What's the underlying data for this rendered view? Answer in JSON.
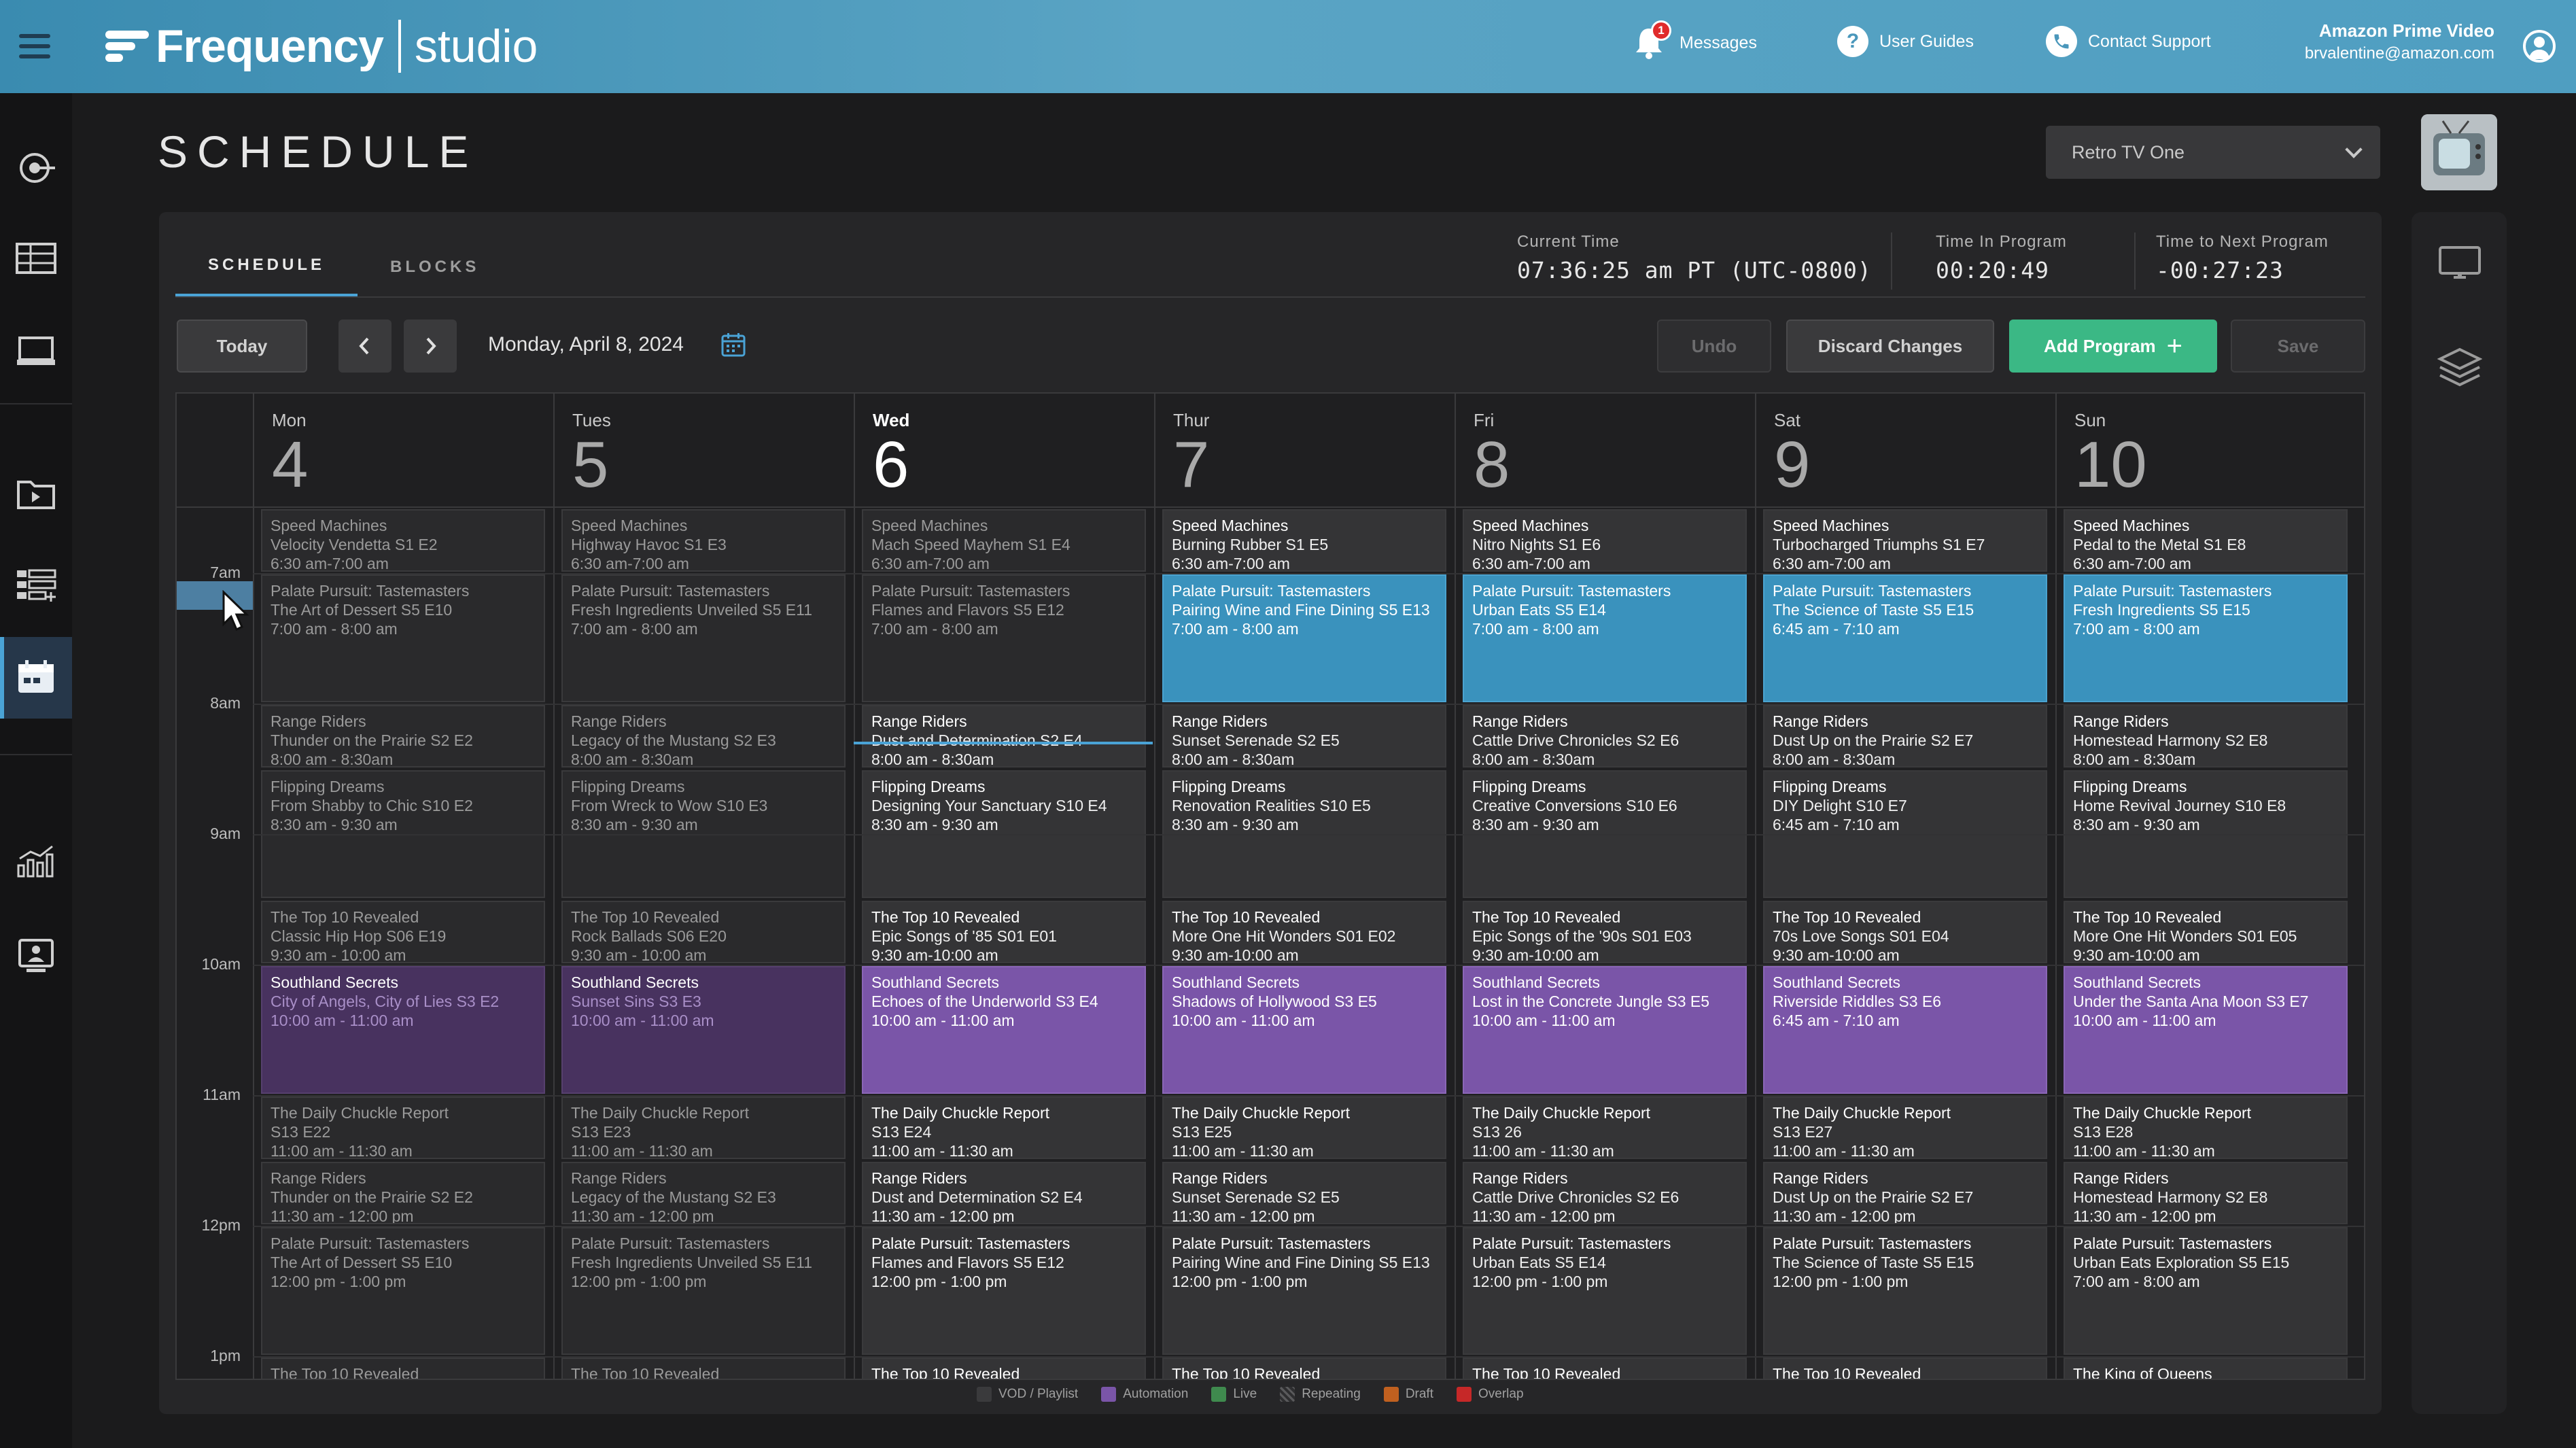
{
  "app": {
    "brand": "Frequency",
    "product": "studio",
    "messages_label": "Messages",
    "messages_badge": "1",
    "guides_label": "User Guides",
    "support_label": "Contact Support",
    "org_name": "Amazon Prime Video",
    "user_email": "brvalentine@amazon.com"
  },
  "page": {
    "title": "SCHEDULE",
    "channel": "Retro TV One"
  },
  "tabs": [
    "SCHEDULE",
    "BLOCKS"
  ],
  "stats": {
    "current_time_label": "Current Time",
    "current_time": "07:36:25 am PT (UTC-0800)",
    "time_in_program_label": "Time In Program",
    "time_in_program": "00:20:49",
    "time_to_next_label": "Time to Next Program",
    "time_to_next": "-00:27:23"
  },
  "toolbar": {
    "today": "Today",
    "date": "Monday, April 8, 2024",
    "undo": "Undo",
    "discard": "Discard Changes",
    "add_program": "Add Program",
    "save": "Save"
  },
  "days": [
    {
      "name": "Mon",
      "num": "4"
    },
    {
      "name": "Tues",
      "num": "5"
    },
    {
      "name": "Wed",
      "num": "6"
    },
    {
      "name": "Thur",
      "num": "7"
    },
    {
      "name": "Fri",
      "num": "8"
    },
    {
      "name": "Sat",
      "num": "9"
    },
    {
      "name": "Sun",
      "num": "10"
    }
  ],
  "times": [
    "7am",
    "8am",
    "9am",
    "10am",
    "11am",
    "12pm",
    "1pm"
  ],
  "events": [
    [
      {
        "l1": "Speed Machines",
        "l2": "Velocity Vendetta S1 E2",
        "l3": "6:30 am-7:00 am",
        "k": "dim"
      },
      {
        "l1": "Palate Pursuit: Tastemasters",
        "l2": "The Art of Dessert S5 E10",
        "l3": "7:00 am - 8:00 am",
        "k": "dim"
      },
      {
        "l1": "Range Riders",
        "l2": "Thunder on the Prairie S2 E2",
        "l3": "8:00 am - 8:30am",
        "k": "dim"
      },
      {
        "l1": "Flipping Dreams",
        "l2": "From Shabby to Chic S10 E2",
        "l3": "8:30 am - 9:30 am",
        "k": "dim"
      },
      {
        "l1": "The Top 10 Revealed",
        "l2": "Classic Hip Hop S06 E19",
        "l3": "9:30 am - 10:00 am",
        "k": "dim"
      },
      {
        "l1": "Southland Secrets",
        "l2": "City of Angels, City of Lies S3 E2",
        "l3": "10:00 am - 11:00 am",
        "k": "purple dim"
      },
      {
        "l1": "The Daily Chuckle Report",
        "l2": "S13 E22",
        "l3": "11:00 am - 11:30 am",
        "k": "dim"
      },
      {
        "l1": "Range Riders",
        "l2": "Thunder on the Prairie S2 E2",
        "l3": "11:30 am - 12:00 pm",
        "k": "dim"
      },
      {
        "l1": "Palate Pursuit: Tastemasters",
        "l2": "The Art of Dessert S5 E10",
        "l3": "12:00 pm - 1:00 pm",
        "k": "dim"
      },
      {
        "l1": "The Top 10 Revealed",
        "l2": "",
        "l3": "",
        "k": "dim"
      }
    ],
    [
      {
        "l1": "Speed Machines",
        "l2": "Highway Havoc S1 E3",
        "l3": "6:30 am-7:00 am",
        "k": "dim"
      },
      {
        "l1": "Palate Pursuit: Tastemasters",
        "l2": "Fresh Ingredients Unveiled S5 E11",
        "l3": "7:00 am - 8:00 am",
        "k": "dim"
      },
      {
        "l1": "Range Riders",
        "l2": "Legacy of the Mustang S2 E3",
        "l3": "8:00 am - 8:30am",
        "k": "dim"
      },
      {
        "l1": "Flipping Dreams",
        "l2": "From Wreck to Wow S10 E3",
        "l3": "8:30 am - 9:30 am",
        "k": "dim"
      },
      {
        "l1": "The Top 10 Revealed",
        "l2": "Rock Ballads S06 E20",
        "l3": "9:30 am - 10:00 am",
        "k": "dim"
      },
      {
        "l1": "Southland Secrets",
        "l2": "Sunset Sins S3 E3",
        "l3": "10:00 am - 11:00 am",
        "k": "purple dim"
      },
      {
        "l1": "The Daily Chuckle Report",
        "l2": "S13 E23",
        "l3": "11:00 am - 11:30 am",
        "k": "dim"
      },
      {
        "l1": "Range Riders",
        "l2": "Legacy of the Mustang S2 E3",
        "l3": "11:30 am - 12:00 pm",
        "k": "dim"
      },
      {
        "l1": "Palate Pursuit: Tastemasters",
        "l2": "Fresh Ingredients Unveiled S5 E11",
        "l3": "12:00 pm - 1:00 pm",
        "k": "dim"
      },
      {
        "l1": "The Top 10 Revealed",
        "l2": "",
        "l3": "",
        "k": "dim"
      }
    ],
    [
      {
        "l1": "Speed Machines",
        "l2": "Mach Speed Mayhem S1 E4",
        "l3": "6:30 am-7:00 am",
        "k": "dim"
      },
      {
        "l1": "Palate Pursuit: Tastemasters",
        "l2": "Flames and Flavors S5 E12",
        "l3": "7:00 am - 8:00 am",
        "k": "dim"
      },
      {
        "l1": "Range Riders",
        "l2": "Dust and Determination S2 E4",
        "l3": "8:00 am - 8:30am",
        "k": "cur"
      },
      {
        "l1": "Flipping Dreams",
        "l2": "Designing Your Sanctuary S10 E4",
        "l3": "8:30 am - 9:30 am",
        "k": "cur"
      },
      {
        "l1": "The Top 10 Revealed",
        "l2": "Epic Songs of '85 S01 E01",
        "l3": "9:30 am-10:00 am",
        "k": "cur"
      },
      {
        "l1": "Southland Secrets",
        "l2": "Echoes of the Underworld S3 E4",
        "l3": "10:00 am - 11:00 am",
        "k": "purple"
      },
      {
        "l1": "The Daily Chuckle Report",
        "l2": "S13 E24",
        "l3": "11:00 am - 11:30 am",
        "k": "cur"
      },
      {
        "l1": "Range Riders",
        "l2": "Dust and Determination S2 E4",
        "l3": "11:30 am - 12:00 pm",
        "k": "cur"
      },
      {
        "l1": "Palate Pursuit: Tastemasters",
        "l2": "Flames and Flavors S5 E12",
        "l3": "12:00 pm - 1:00 pm",
        "k": "cur"
      },
      {
        "l1": "The Top 10 Revealed",
        "l2": "",
        "l3": "",
        "k": "cur"
      }
    ],
    [
      {
        "l1": "Speed Machines",
        "l2": "Burning Rubber S1 E5",
        "l3": "6:30 am-7:00 am",
        "k": "cur"
      },
      {
        "l1": "Palate Pursuit: Tastemasters",
        "l2": "Pairing Wine and Fine Dining S5 E13",
        "l3": "7:00 am - 8:00 am",
        "k": "blue"
      },
      {
        "l1": "Range Riders",
        "l2": "Sunset Serenade S2 E5",
        "l3": "8:00 am - 8:30am",
        "k": "cur"
      },
      {
        "l1": "Flipping Dreams",
        "l2": "Renovation Realities S10 E5",
        "l3": "8:30 am - 9:30 am",
        "k": "cur"
      },
      {
        "l1": "The Top 10 Revealed",
        "l2": "More One Hit Wonders S01 E02",
        "l3": "9:30 am-10:00 am",
        "k": "cur"
      },
      {
        "l1": "Southland Secrets",
        "l2": "Shadows of Hollywood S3 E5",
        "l3": "10:00 am - 11:00 am",
        "k": "purple"
      },
      {
        "l1": "The Daily Chuckle Report",
        "l2": "S13 E25",
        "l3": "11:00 am - 11:30 am",
        "k": "cur"
      },
      {
        "l1": "Range Riders",
        "l2": "Sunset Serenade S2 E5",
        "l3": "11:30 am - 12:00 pm",
        "k": "cur"
      },
      {
        "l1": "Palate Pursuit: Tastemasters",
        "l2": "Pairing Wine and Fine Dining S5 E13",
        "l3": "12:00 pm - 1:00 pm",
        "k": "cur"
      },
      {
        "l1": "The Top 10 Revealed",
        "l2": "",
        "l3": "",
        "k": "cur"
      }
    ],
    [
      {
        "l1": "Speed Machines",
        "l2": "Nitro Nights S1 E6",
        "l3": "6:30 am-7:00 am",
        "k": "cur"
      },
      {
        "l1": "Palate Pursuit: Tastemasters",
        "l2": "Urban Eats S5 E14",
        "l3": "7:00 am - 8:00 am",
        "k": "blue"
      },
      {
        "l1": "Range Riders",
        "l2": "Cattle Drive Chronicles S2 E6",
        "l3": "8:00 am - 8:30am",
        "k": "cur"
      },
      {
        "l1": "Flipping Dreams",
        "l2": "Creative Conversions S10 E6",
        "l3": "8:30 am - 9:30 am",
        "k": "cur"
      },
      {
        "l1": "The Top 10 Revealed",
        "l2": "Epic Songs of the '90s S01 E03",
        "l3": "9:30 am-10:00 am",
        "k": "cur"
      },
      {
        "l1": "Southland Secrets",
        "l2": "Lost in the Concrete Jungle S3 E5",
        "l3": "10:00 am - 11:00 am",
        "k": "purple"
      },
      {
        "l1": "The Daily Chuckle Report",
        "l2": "S13 26",
        "l3": "11:00 am - 11:30 am",
        "k": "cur"
      },
      {
        "l1": "Range Riders",
        "l2": "Cattle Drive Chronicles S2 E6",
        "l3": "11:30 am - 12:00 pm",
        "k": "cur"
      },
      {
        "l1": "Palate Pursuit: Tastemasters",
        "l2": "Urban Eats S5 E14",
        "l3": "12:00 pm - 1:00 pm",
        "k": "cur"
      },
      {
        "l1": "The Top 10 Revealed",
        "l2": "",
        "l3": "",
        "k": "cur"
      }
    ],
    [
      {
        "l1": "Speed Machines",
        "l2": "Turbocharged Triumphs S1 E7",
        "l3": "6:30 am-7:00 am",
        "k": "cur"
      },
      {
        "l1": "Palate Pursuit: Tastemasters",
        "l2": "The Science of Taste S5 E15",
        "l3": "6:45 am - 7:10 am",
        "k": "blue"
      },
      {
        "l1": "Range Riders",
        "l2": "Dust Up on the Prairie S2 E7",
        "l3": "8:00 am - 8:30am",
        "k": "cur"
      },
      {
        "l1": "Flipping Dreams",
        "l2": "DIY Delight S10 E7",
        "l3": "6:45 am - 7:10 am",
        "k": "cur"
      },
      {
        "l1": "The Top 10 Revealed",
        "l2": "70s Love Songs S01 E04",
        "l3": "9:30 am-10:00 am",
        "k": "cur"
      },
      {
        "l1": "Southland Secrets",
        "l2": "Riverside Riddles S3 E6",
        "l3": "6:45 am - 7:10 am",
        "k": "purple"
      },
      {
        "l1": "The Daily Chuckle Report",
        "l2": "S13 E27",
        "l3": "11:00 am - 11:30 am",
        "k": "cur"
      },
      {
        "l1": "Range Riders",
        "l2": "Dust Up on the Prairie S2 E7",
        "l3": "11:30 am - 12:00 pm",
        "k": "cur"
      },
      {
        "l1": "Palate Pursuit: Tastemasters",
        "l2": "The Science of Taste S5 E15",
        "l3": "12:00 pm - 1:00 pm",
        "k": "cur"
      },
      {
        "l1": "The Top 10 Revealed",
        "l2": "",
        "l3": "",
        "k": "cur"
      }
    ],
    [
      {
        "l1": "Speed Machines",
        "l2": "Pedal to the Metal S1 E8",
        "l3": "6:30 am-7:00 am",
        "k": "cur"
      },
      {
        "l1": "Palate Pursuit: Tastemasters",
        "l2": "Fresh Ingredients S5 E15",
        "l3": "7:00 am - 8:00 am",
        "k": "blue"
      },
      {
        "l1": "Range Riders",
        "l2": "Homestead Harmony S2 E8",
        "l3": "8:00 am - 8:30am",
        "k": "cur"
      },
      {
        "l1": "Flipping Dreams",
        "l2": "Home Revival Journey S10 E8",
        "l3": "8:30 am - 9:30 am",
        "k": "cur"
      },
      {
        "l1": "The Top 10 Revealed",
        "l2": " More One Hit Wonders S01 E05",
        "l3": "9:30 am-10:00 am",
        "k": "cur"
      },
      {
        "l1": "Southland Secrets",
        "l2": "Under the Santa Ana Moon S3 E7",
        "l3": "10:00 am - 11:00 am",
        "k": "purple"
      },
      {
        "l1": "The Daily Chuckle Report",
        "l2": "S13 E28",
        "l3": "11:00 am - 11:30 am",
        "k": "cur"
      },
      {
        "l1": "Range Riders",
        "l2": "Homestead Harmony S2 E8",
        "l3": "11:30 am - 12:00 pm",
        "k": "cur"
      },
      {
        "l1": "Palate Pursuit: Tastemasters",
        "l2": "Urban Eats Exploration S5 E15",
        "l3": "7:00 am - 8:00 am",
        "k": "cur"
      },
      {
        "l1": "The King of Queens",
        "l2": "",
        "l3": "",
        "k": "cur"
      }
    ]
  ],
  "legend": [
    {
      "label": "VOD / Playlist",
      "color": "#3a3a3c"
    },
    {
      "label": "Automation",
      "color": "#7a55a8"
    },
    {
      "label": "Live",
      "color": "#3f8a4e"
    },
    {
      "label": "Repeating",
      "color": "#2e2e30"
    },
    {
      "label": "Draft",
      "color": "#c0601f"
    },
    {
      "label": "Overlap",
      "color": "#c62828"
    }
  ]
}
